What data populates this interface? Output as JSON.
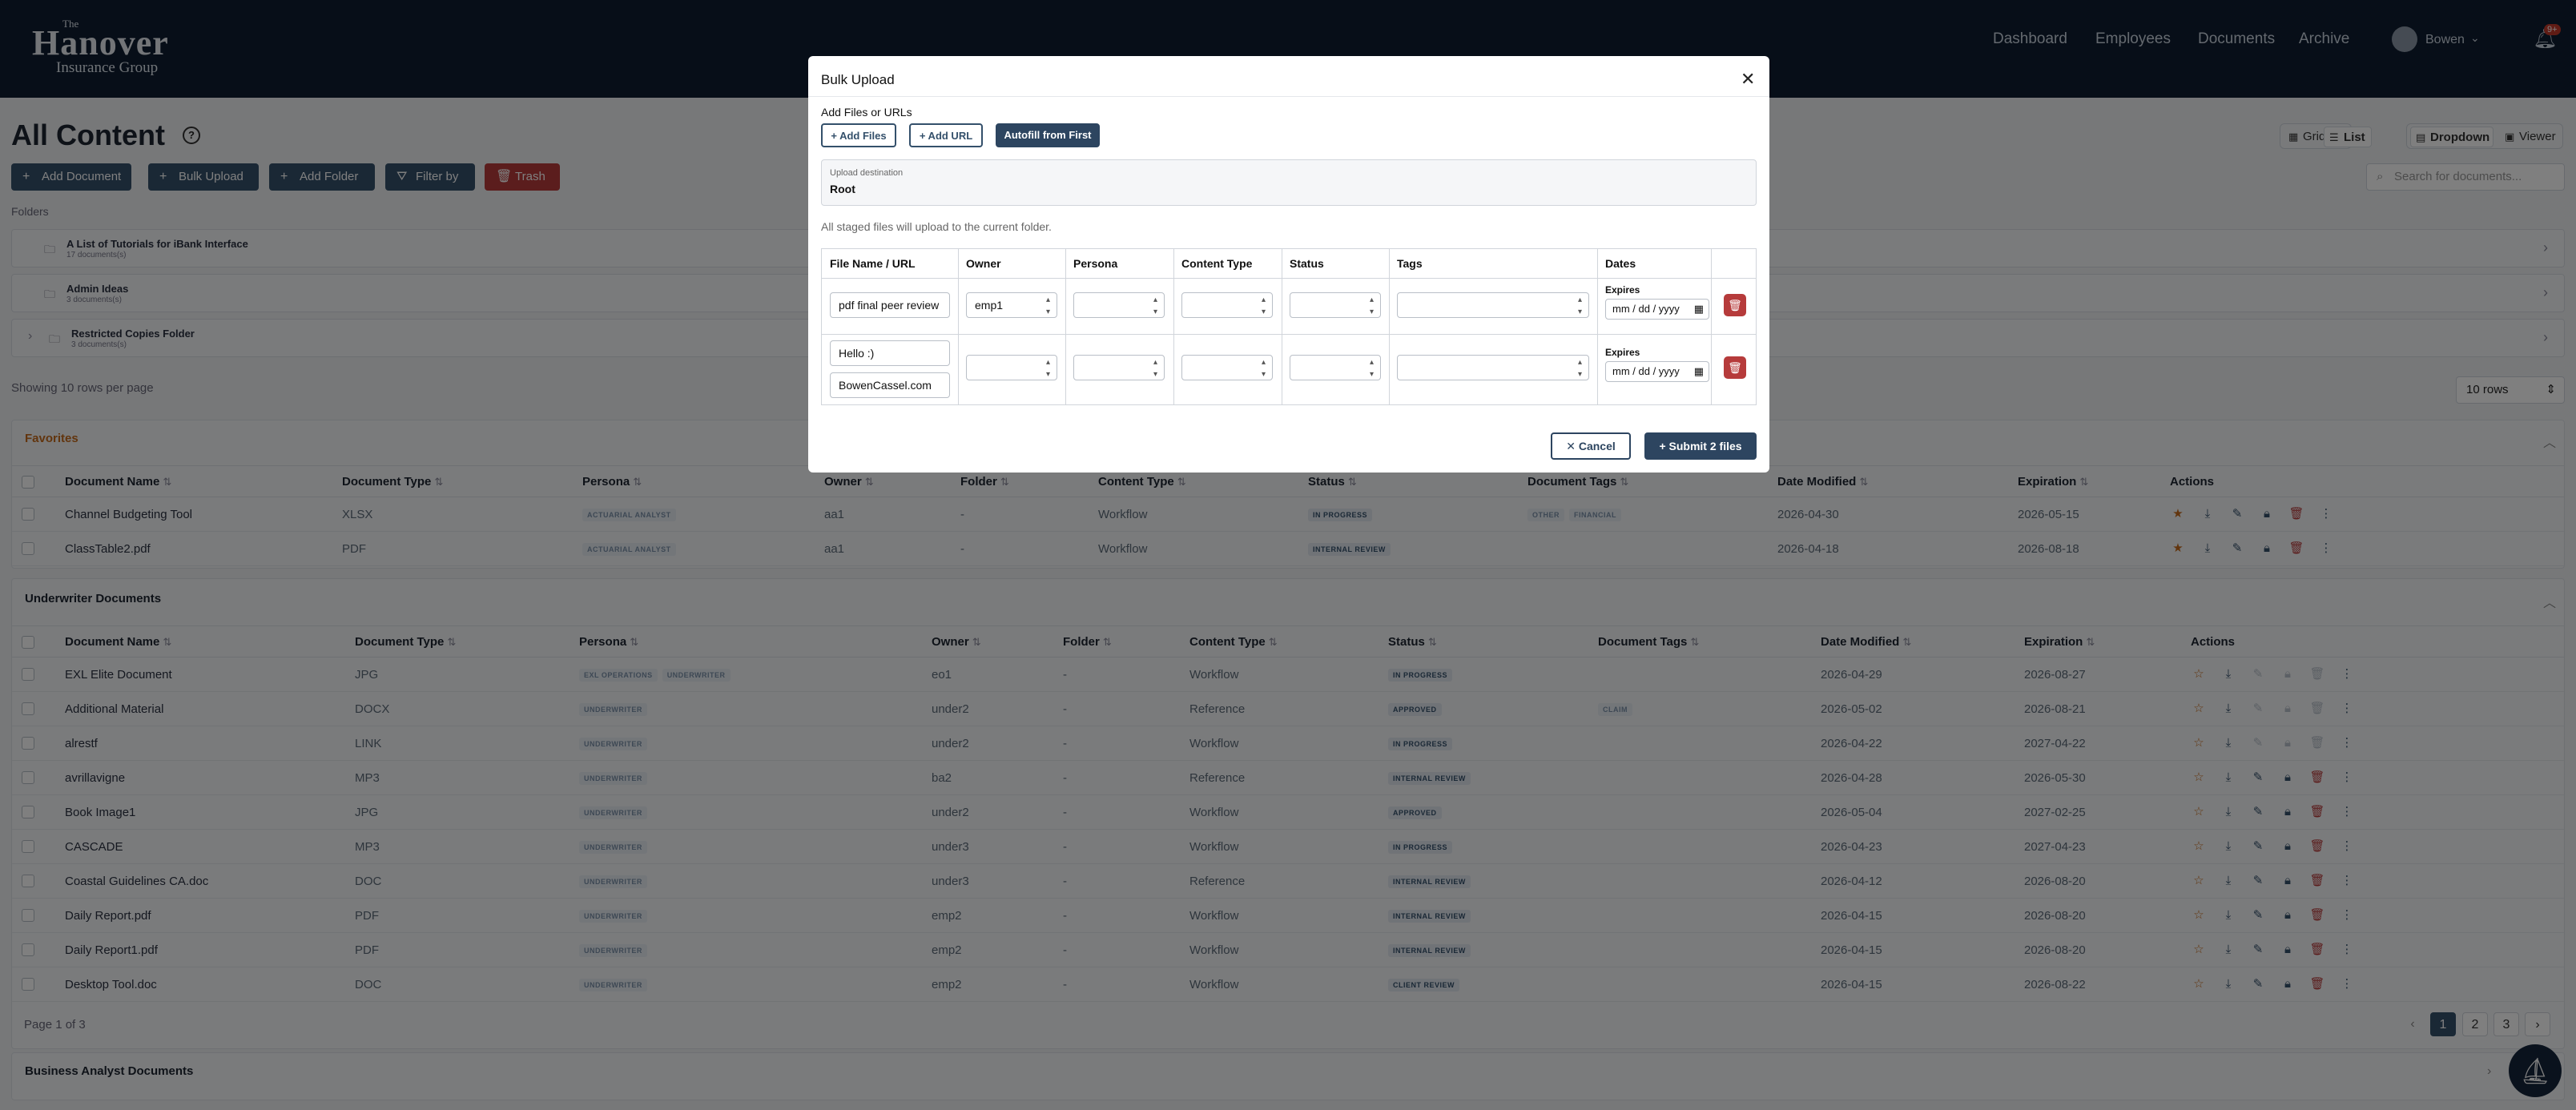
{
  "brand": {
    "the": "The",
    "name": "Hanover",
    "sub": "Insurance Group"
  },
  "nav": [
    "Dashboard",
    "Employees",
    "Documents",
    "Archive"
  ],
  "user": {
    "name": "Bowen"
  },
  "notifications": "9+",
  "page": {
    "title": "All Content",
    "buttons": [
      "Add Document",
      "Bulk Upload",
      "Add Folder",
      "Filter by",
      "Trash"
    ],
    "view": {
      "grid": "Grid",
      "list": "List",
      "dropdown": "Dropdown",
      "viewer": "Viewer"
    },
    "search_placeholder": "Search for documents...",
    "folders_label": "Folders",
    "folders": [
      {
        "name": "A List of Tutorials for iBank Interface",
        "count": "17 documents(s)"
      },
      {
        "name": "Admin Ideas",
        "count": "3 documents(s)"
      },
      {
        "name": "Restricted Copies Folder",
        "count": "3 documents(s)"
      }
    ],
    "showing": "Showing 10 rows per page",
    "rows_select": "10 rows"
  },
  "favorites": {
    "title": "Favorites",
    "columns": [
      "Document Name",
      "Document Type",
      "Persona",
      "Owner",
      "Folder",
      "Content Type",
      "Status",
      "Document Tags",
      "Date Modified",
      "Expiration",
      "Actions"
    ],
    "rows": [
      {
        "name": "Channel Budgeting Tool",
        "type": "XLSX",
        "persona": [
          "ACTUARIAL ANALYST"
        ],
        "owner": "aa1",
        "folder": "-",
        "ctype": "Workflow",
        "status": "IN PROGRESS",
        "tags": [
          "OTHER",
          "FINANCIAL"
        ],
        "modified": "2026-04-30",
        "expires": "2026-05-15"
      },
      {
        "name": "ClassTable2.pdf",
        "type": "PDF",
        "persona": [
          "ACTUARIAL ANALYST"
        ],
        "owner": "aa1",
        "folder": "-",
        "ctype": "Workflow",
        "status": "INTERNAL REVIEW",
        "tags": [],
        "modified": "2026-04-18",
        "expires": "2026-08-18"
      }
    ]
  },
  "underwriter": {
    "title": "Underwriter Documents",
    "columns": [
      "Document Name",
      "Document Type",
      "Persona",
      "Owner",
      "Folder",
      "Content Type",
      "Status",
      "Document Tags",
      "Date Modified",
      "Expiration",
      "Actions"
    ],
    "rows": [
      {
        "name": "EXL Elite Document",
        "type": "JPG",
        "persona": [
          "EXL OPERATIONS",
          "UNDERWRITER"
        ],
        "owner": "eo1",
        "folder": "-",
        "ctype": "Workflow",
        "status": "IN PROGRESS",
        "tags": [],
        "modified": "2026-04-29",
        "expires": "2026-08-27"
      },
      {
        "name": "Additional Material",
        "type": "DOCX",
        "persona": [
          "UNDERWRITER"
        ],
        "owner": "under2",
        "folder": "-",
        "ctype": "Reference",
        "status": "APPROVED",
        "tags": [
          "CLAIM"
        ],
        "modified": "2026-05-02",
        "expires": "2026-08-21"
      },
      {
        "name": "alrestf",
        "type": "LINK",
        "persona": [
          "UNDERWRITER"
        ],
        "owner": "under2",
        "folder": "-",
        "ctype": "Workflow",
        "status": "IN PROGRESS",
        "tags": [],
        "modified": "2026-04-22",
        "expires": "2027-04-22"
      },
      {
        "name": "avrillavigne",
        "type": "MP3",
        "persona": [
          "UNDERWRITER"
        ],
        "owner": "ba2",
        "folder": "-",
        "ctype": "Reference",
        "status": "INTERNAL REVIEW",
        "tags": [],
        "modified": "2026-04-28",
        "expires": "2026-05-30"
      },
      {
        "name": "Book Image1",
        "type": "JPG",
        "persona": [
          "UNDERWRITER"
        ],
        "owner": "under2",
        "folder": "-",
        "ctype": "Workflow",
        "status": "APPROVED",
        "tags": [],
        "modified": "2026-05-04",
        "expires": "2027-02-25"
      },
      {
        "name": "CASCADE",
        "type": "MP3",
        "persona": [
          "UNDERWRITER"
        ],
        "owner": "under3",
        "folder": "-",
        "ctype": "Workflow",
        "status": "IN PROGRESS",
        "tags": [],
        "modified": "2026-04-23",
        "expires": "2027-04-23"
      },
      {
        "name": "Coastal Guidelines CA.doc",
        "type": "DOC",
        "persona": [
          "UNDERWRITER"
        ],
        "owner": "under3",
        "folder": "-",
        "ctype": "Reference",
        "status": "INTERNAL REVIEW",
        "tags": [],
        "modified": "2026-04-12",
        "expires": "2026-08-20"
      },
      {
        "name": "Daily Report.pdf",
        "type": "PDF",
        "persona": [
          "UNDERWRITER"
        ],
        "owner": "emp2",
        "folder": "-",
        "ctype": "Workflow",
        "status": "INTERNAL REVIEW",
        "tags": [],
        "modified": "2026-04-15",
        "expires": "2026-08-20"
      },
      {
        "name": "Daily Report1.pdf",
        "type": "PDF",
        "persona": [
          "UNDERWRITER"
        ],
        "owner": "emp2",
        "folder": "-",
        "ctype": "Workflow",
        "status": "INTERNAL REVIEW",
        "tags": [],
        "modified": "2026-04-15",
        "expires": "2026-08-20"
      },
      {
        "name": "Desktop Tool.doc",
        "type": "DOC",
        "persona": [
          "UNDERWRITER"
        ],
        "owner": "emp2",
        "folder": "-",
        "ctype": "Workflow",
        "status": "CLIENT REVIEW",
        "tags": [],
        "modified": "2026-04-15",
        "expires": "2026-08-22"
      }
    ],
    "page_info": "Page 1 of 3",
    "pages": [
      "1",
      "2",
      "3"
    ]
  },
  "business": {
    "title": "Business Analyst Documents"
  },
  "modal": {
    "title": "Bulk Upload",
    "add_label": "Add Files or URLs",
    "add_files": "+ Add Files",
    "add_url": "+ Add URL",
    "autofill": "Autofill from First",
    "dest_label": "Upload destination",
    "dest_value": "Root",
    "note": "All staged files will upload to the current folder.",
    "columns": [
      "File Name / URL",
      "Owner",
      "Persona",
      "Content Type",
      "Status",
      "Tags",
      "Dates"
    ],
    "rows": [
      {
        "file": "pdf final peer review",
        "owner": "emp1",
        "expires_label": "Expires",
        "date_placeholder": "mm / dd / yyyy"
      },
      {
        "file": "Hello :)",
        "url": "BowenCassel.com",
        "owner": "",
        "expires_label": "Expires",
        "date_placeholder": "mm / dd / yyyy"
      }
    ],
    "cancel": "✕ Cancel",
    "submit": "+ Submit 2 files"
  }
}
